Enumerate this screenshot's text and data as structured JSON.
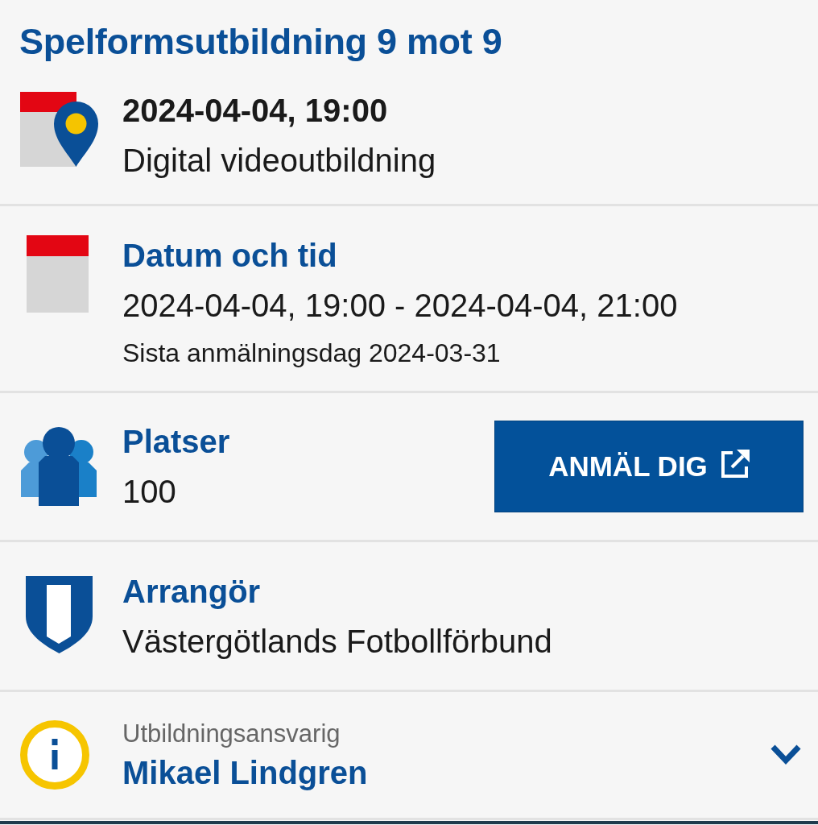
{
  "title": "Spelformsutbildning 9 mot 9",
  "sections": [
    {
      "kind": "summary",
      "heading": "2024-04-04, 19:00",
      "text": "Digital videoutbildning"
    },
    {
      "kind": "datetime",
      "heading": "Datum och tid",
      "text": "2024-04-04, 19:00 - 2024-04-04, 21:00",
      "note": "Sista anmälningsdag 2024-03-31"
    },
    {
      "kind": "seats",
      "heading": "Platser",
      "text": "100",
      "button": {
        "label": "ANMÄL DIG"
      }
    },
    {
      "kind": "organizer",
      "heading": "Arrangör",
      "text": "Västergötlands Fotbollförbund"
    },
    {
      "kind": "contact",
      "label": "Utbildningsansvarig",
      "name": "Mikael Lindgren",
      "expanded": false
    }
  ]
}
